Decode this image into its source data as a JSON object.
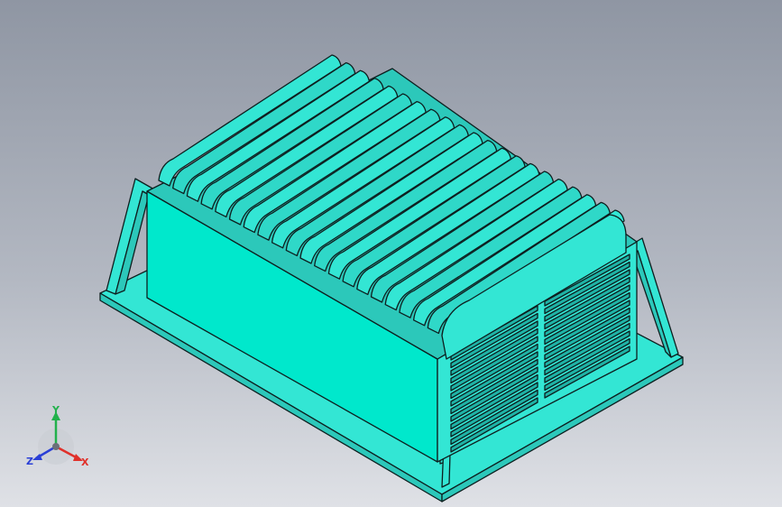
{
  "triad": {
    "y_label": "Y",
    "x_label": "X",
    "z_label": "Z"
  },
  "colors": {
    "model_fill": "#33e6d4",
    "model_front": "#00e8cc",
    "model_shade": "#2cc8ba",
    "outline": "#0d1f1f",
    "axis_y": "#22b14c",
    "axis_x": "#e0302a",
    "axis_z": "#2a3fd6"
  }
}
